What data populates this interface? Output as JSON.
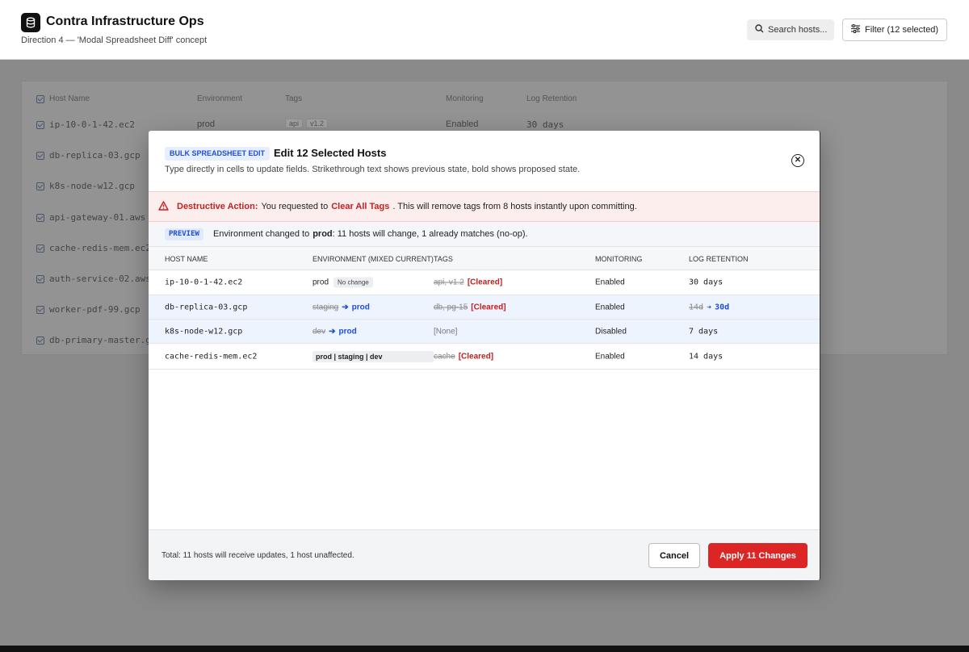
{
  "header": {
    "title": "Contra Infrastructure Ops",
    "subtitle": "Direction 4 — 'Modal Spreadsheet Diff' concept",
    "search_label": "Search hosts...",
    "filter_label": "Filter (12 selected)"
  },
  "background_table": {
    "columns": [
      "Host Name",
      "Environment",
      "Tags",
      "Monitoring",
      "Log Retention"
    ],
    "first_row": {
      "environment": "prod",
      "tags": [
        "api",
        "v1.2"
      ],
      "monitoring": "Enabled",
      "retention": "30 days"
    },
    "hosts": [
      "ip-10-0-1-42.ec2",
      "db-replica-03.gcp",
      "k8s-node-w12.gcp",
      "api-gateway-01.aws",
      "cache-redis-mem.ec2",
      "auth-service-02.aws",
      "worker-pdf-99.gcp",
      "db-primary-master.g"
    ]
  },
  "modal": {
    "badge": "BULK SPREADSHEET EDIT",
    "title": "Edit 12 Selected Hosts",
    "description": "Type directly in cells to update fields. Strikethrough text shows previous state, bold shows proposed state.",
    "close_icon": "close-circle-icon",
    "warning": {
      "label": "Destructive Action:",
      "text_before": "You requested to",
      "action": "Clear All Tags",
      "text_after": ". This will remove tags from 8 hosts instantly upon committing."
    },
    "preview": {
      "badge": "PREVIEW",
      "text_before": "Environment changed to",
      "env": "prod",
      "text_after": ": 11 hosts will change, 1 already matches (no-op)."
    },
    "columns": [
      "HOST NAME",
      "ENVIRONMENT (MIXED CURRENT)",
      "TAGS",
      "MONITORING",
      "LOG RETENTION"
    ],
    "rows": [
      {
        "host": "ip-10-0-1-42.ec2",
        "env_old": "prod",
        "env_note": "No change",
        "tags_old": "api, v1.2",
        "tags_new": "[Cleared]",
        "monitoring": "Enabled",
        "retention": "30 days"
      },
      {
        "host": "db-replica-03.gcp",
        "env_old": "staging",
        "env_new": "prod",
        "tags_old": "db, pg-15",
        "tags_new": "[Cleared]",
        "monitoring": "Enabled",
        "retention_old": "14d",
        "retention_new": "30d"
      },
      {
        "host": "k8s-node-w12.gcp",
        "env_old": "dev",
        "env_new": "prod",
        "tags_none": "[None]",
        "monitoring": "Disabled",
        "retention": "7 days"
      },
      {
        "host": "cache-redis-mem.ec2",
        "env_mixed": "prod | staging | dev",
        "tags_old": "cache",
        "tags_new": "[Cleared]",
        "monitoring": "Enabled",
        "retention": "14 days"
      }
    ],
    "footer_text": "Total: 11 hosts will receive updates, 1 host unaffected.",
    "cancel_label": "Cancel",
    "apply_label": "Apply 11 Changes"
  },
  "colors": {
    "accent": "#1d4ed8",
    "danger": "#dc2626",
    "changed_row": "#eef4fe"
  }
}
